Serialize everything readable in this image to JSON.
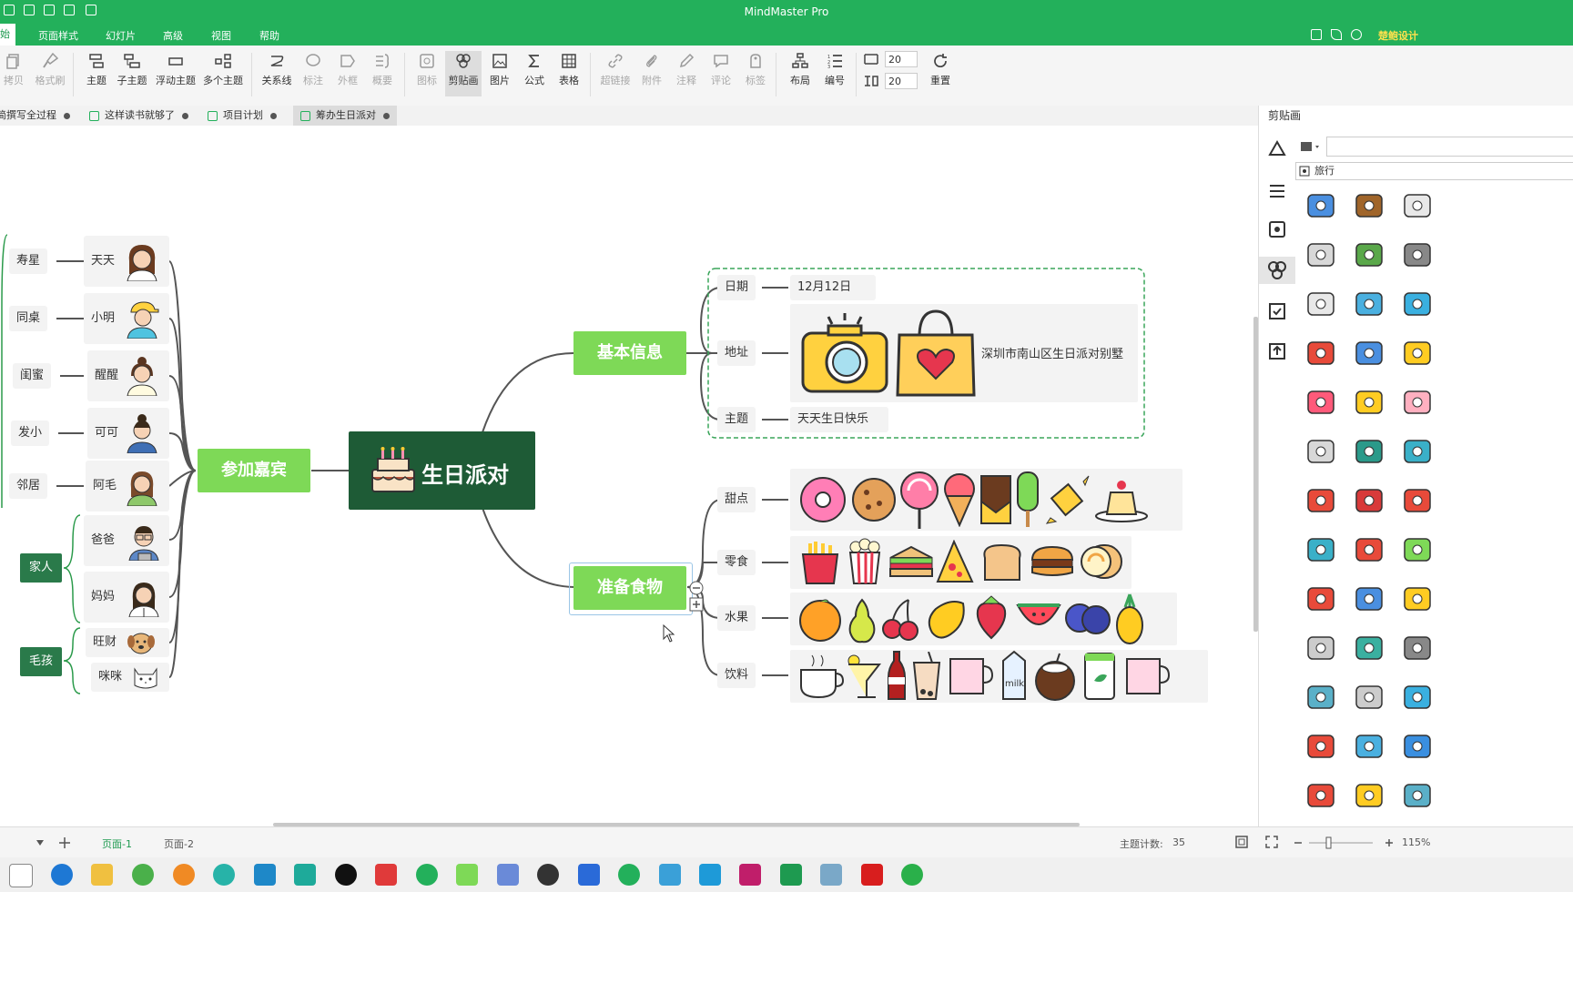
{
  "app": {
    "title": "MindMaster Pro"
  },
  "menu": {
    "items": [
      "始",
      "页面样式",
      "幻灯片",
      "高级",
      "视图",
      "帮助"
    ],
    "user": "楚鲍设计"
  },
  "toolbar": {
    "tools": [
      "拷贝",
      "格式刷",
      "主题",
      "子主题",
      "浮动主题",
      "多个主题",
      "关系线",
      "标注",
      "外框",
      "概要",
      "图标",
      "剪贴画",
      "图片",
      "公式",
      "表格",
      "超链接",
      "附件",
      "注释",
      "评论",
      "标签",
      "布局",
      "编号",
      "重置"
    ],
    "spacing_h": "20",
    "spacing_v": "20"
  },
  "doc_tabs": [
    "简撰写全过程",
    "这样读书就够了",
    "项目计划",
    "筹办生日派对"
  ],
  "mindmap": {
    "center": "生日派对",
    "guests": {
      "label": "参加嘉宾",
      "people": [
        {
          "name": "天天",
          "role": "寿星"
        },
        {
          "name": "小明",
          "role": "同桌"
        },
        {
          "name": "醒醒",
          "role": "闺蜜"
        },
        {
          "name": "可可",
          "role": "发小"
        },
        {
          "name": "阿毛",
          "role": "邻居"
        },
        {
          "name": "爸爸",
          "role": ""
        },
        {
          "name": "妈妈",
          "role": ""
        },
        {
          "name": "旺财",
          "role": ""
        },
        {
          "name": "咪咪",
          "role": ""
        }
      ],
      "groups": [
        "家人",
        "毛孩"
      ]
    },
    "info": {
      "label": "基本信息",
      "date_label": "日期",
      "date_value": "12月12日",
      "addr_label": "地址",
      "addr_value": "深圳市南山区生日派对别墅",
      "theme_label": "主题",
      "theme_value": "天天生日快乐"
    },
    "food": {
      "label": "准备食物",
      "categories": [
        "甜点",
        "零食",
        "水果",
        "饮料"
      ]
    }
  },
  "panel": {
    "title": "剪贴画",
    "category": "旅行",
    "clipart": [
      "credit-card",
      "wallet",
      "notepad",
      "ticket",
      "mountain",
      "stopwatch",
      "passport",
      "boarding-pass",
      "taxi",
      "luggage",
      "building",
      "cocktail",
      "popsicle",
      "coins",
      "ice-cream",
      "map",
      "heart-map",
      "flip-flops",
      "train",
      "umbrella",
      "bus",
      "hair-dryer",
      "hat",
      "backpack",
      "location-pin",
      "airplane",
      "scooter",
      "tram",
      "double-bus",
      "traffic-light",
      "bus-front",
      "ship",
      "boat",
      "tractor",
      "bicycle",
      "sailboat",
      "motorcycle",
      "submarine",
      "moped"
    ]
  },
  "status": {
    "pages": [
      "页面-1",
      "页面-2"
    ],
    "topic_count_label": "主题计数:",
    "topic_count": "35",
    "zoom": "115%"
  },
  "colors": {
    "brand": "#23b05b",
    "subtopic": "#7ed957",
    "center": "#1e5b36",
    "group": "#2a7a4a"
  }
}
